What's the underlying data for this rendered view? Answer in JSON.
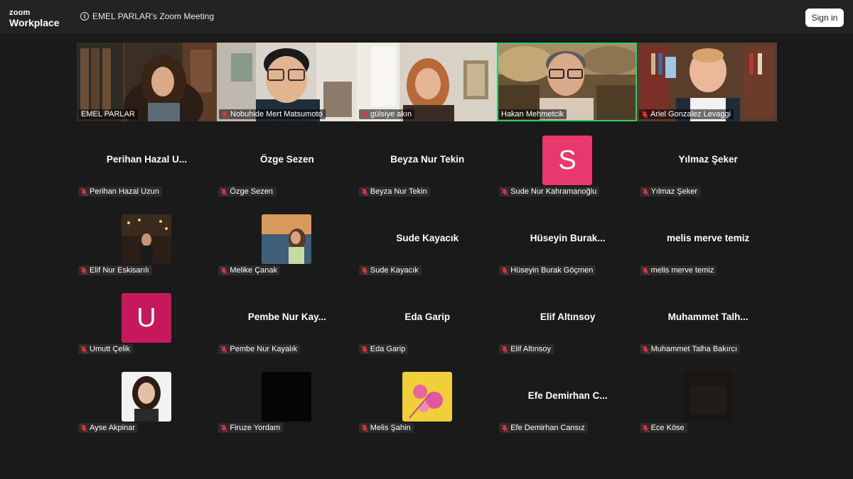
{
  "app": {
    "logo_line1": "zoom",
    "logo_line2": "Workplace",
    "meeting_title": "EMEL PARLAR's Zoom Meeting",
    "sign_in": "Sign in"
  },
  "colors": {
    "background": "#1a1a1a",
    "active_speaker": "#2ecc71",
    "mute_icon": "#e0323c"
  },
  "video_participants": [
    {
      "name": "EMEL PARLAR",
      "muted": false
    },
    {
      "name": "Nobuhide Mert Matsumoto",
      "muted": true
    },
    {
      "name": "gülsiye akın",
      "muted": true
    },
    {
      "name": "Hakan Mehmetcik",
      "muted": false,
      "active": true
    },
    {
      "name": "Ariel Gonzalez Levaggi",
      "muted": true
    }
  ],
  "grid_participants": [
    {
      "display": "Perihan  Hazal  U...",
      "label": "Perihan Hazal Uzun"
    },
    {
      "display": "Özge Sezen",
      "label": "Özge Sezen"
    },
    {
      "display": "Beyza Nur Tekin",
      "label": "Beyza Nur Tekin"
    },
    {
      "avatar_letter": "S",
      "avatar_color": "#e8386d",
      "label": "Sude Nur Kahramanoğlu"
    },
    {
      "display": "Yılmaz Şeker",
      "label": "Yılmaz Şeker"
    },
    {
      "avatar_photo": "photo-night-city",
      "label": "Elif Nur Eskisarılı"
    },
    {
      "avatar_photo": "photo-seaside-girl",
      "label": "Melike Çanak"
    },
    {
      "display": "Sude Kayacık",
      "label": "Sude Kayacık"
    },
    {
      "display": "Hüseyin  Burak...",
      "label": "Hüseyin Burak Göçmen"
    },
    {
      "display": "melis merve temiz",
      "label": "melis merve temiz"
    },
    {
      "avatar_letter": "U",
      "avatar_color": "#c7185b",
      "label": "Umutt Çelik"
    },
    {
      "display": "Pembe  Nur  Kay...",
      "label": "Pembe Nur Kayalık"
    },
    {
      "display": "Eda Garip",
      "label": "Eda Garip"
    },
    {
      "display": "Elif Altınsoy",
      "label": "Elif Altınsoy"
    },
    {
      "display": "Muhammet  Talh...",
      "label": "Muhammet Talha Bakırcı"
    },
    {
      "avatar_photo": "photo-portrait-woman",
      "label": "Ayse Akpinar"
    },
    {
      "avatar_photo": "photo-black",
      "label": "Firuze Yordam"
    },
    {
      "avatar_photo": "photo-pink-flowers",
      "label": "Melis Şahin"
    },
    {
      "display": "Efe  Demirhan  C...",
      "label": "Efe Demirhan Cansız"
    },
    {
      "avatar_photo": "photo-dark",
      "label": "Ece Köse"
    }
  ]
}
